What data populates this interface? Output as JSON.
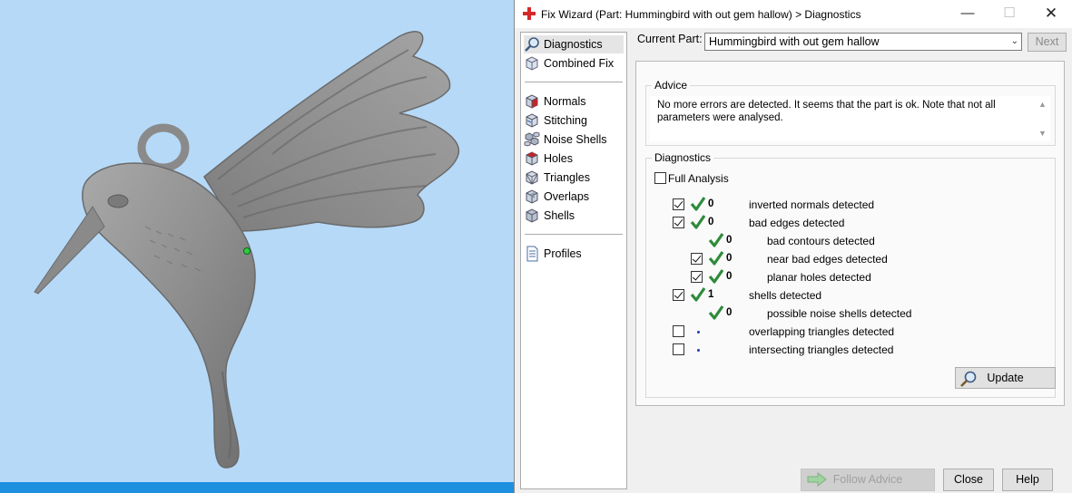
{
  "window": {
    "title": "Fix Wizard (Part: Hummingbird with out gem hallow) > Diagnostics",
    "minimize_glyph": "—",
    "maximize_glyph": "☐",
    "close_glyph": "✕"
  },
  "nav": {
    "top": [
      {
        "label": "Diagnostics",
        "icon": "magnifier-icon"
      },
      {
        "label": "Combined Fix",
        "icon": "cube-icon"
      }
    ],
    "fixes": [
      {
        "label": "Normals",
        "icon": "normals-cube-icon"
      },
      {
        "label": "Stitching",
        "icon": "stitching-cube-icon"
      },
      {
        "label": "Noise Shells",
        "icon": "noise-shells-icon"
      },
      {
        "label": "Holes",
        "icon": "holes-cube-icon"
      },
      {
        "label": "Triangles",
        "icon": "triangles-cube-icon"
      },
      {
        "label": "Overlaps",
        "icon": "overlaps-cube-icon"
      },
      {
        "label": "Shells",
        "icon": "shells-cube-icon"
      }
    ],
    "bottom": [
      {
        "label": "Profiles",
        "icon": "document-icon"
      }
    ]
  },
  "current_part": {
    "label": "Current Part:",
    "value": "Hummingbird with out gem hallow",
    "next_label": "Next"
  },
  "advice": {
    "legend": "Advice",
    "text": "No more errors are detected. It seems that the part is ok. Note that not all parameters were analysed."
  },
  "diagnostics": {
    "legend": "Diagnostics",
    "full_analysis_label": "Full Analysis",
    "full_analysis_checked": false,
    "rows": [
      {
        "checked": true,
        "status": "ok",
        "count": "0",
        "label": "inverted normals detected",
        "level": 0
      },
      {
        "checked": true,
        "status": "ok",
        "count": "0",
        "label": "bad edges detected",
        "level": 0
      },
      {
        "checked": null,
        "status": "ok",
        "count": "0",
        "label": "bad contours detected",
        "level": 1
      },
      {
        "checked": true,
        "status": "ok",
        "count": "0",
        "label": "near bad edges detected",
        "level": 1
      },
      {
        "checked": true,
        "status": "ok",
        "count": "0",
        "label": "planar holes detected",
        "level": 1
      },
      {
        "checked": true,
        "status": "ok",
        "count": "1",
        "label": "shells detected",
        "level": 0
      },
      {
        "checked": null,
        "status": "ok",
        "count": "0",
        "label": "possible noise shells detected",
        "level": 1
      },
      {
        "checked": false,
        "status": "pending",
        "count": "",
        "label": "overlapping triangles detected",
        "level": 0
      },
      {
        "checked": false,
        "status": "pending",
        "count": "",
        "label": "intersecting triangles detected",
        "level": 0
      }
    ],
    "update_label": "Update"
  },
  "footer": {
    "follow_advice_label": "Follow Advice",
    "close_label": "Close",
    "help_label": "Help"
  },
  "colors": {
    "viewport_bg": "#b6d9f8",
    "model_gray": "#8c8c8c",
    "ok_green": "#2e8b3a",
    "pending_blue": "#1e3faa"
  }
}
